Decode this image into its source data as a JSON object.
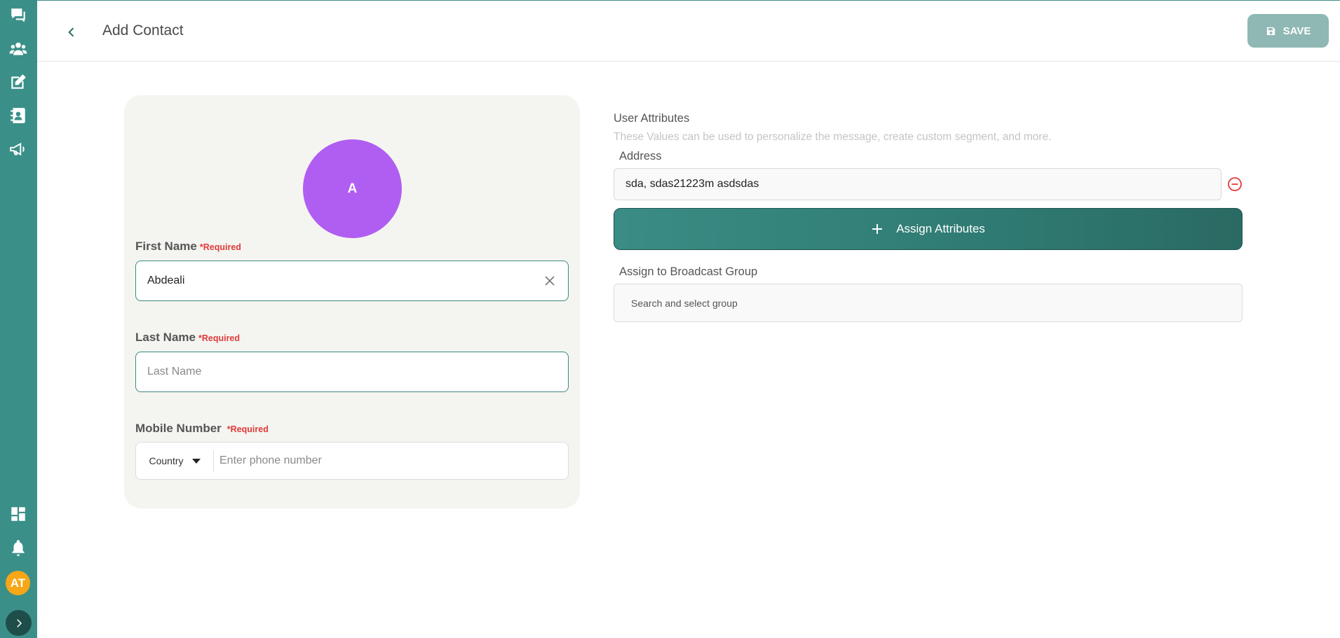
{
  "sidebar": {
    "icons": [
      "chat-icon",
      "users-icon",
      "edit-icon",
      "contacts-icon",
      "megaphone-icon"
    ],
    "bottom_icons": [
      "dashboard-icon",
      "bell-icon"
    ],
    "user_initials": "AT"
  },
  "header": {
    "title": "Add Contact",
    "save_label": "SAVE"
  },
  "contact_card": {
    "avatar_initial": "A",
    "avatar_color": "#b05ef2",
    "first_name": {
      "label": "First Name",
      "required": "*Required",
      "value": "Abdeali"
    },
    "last_name": {
      "label": "Last Name",
      "required": "*Required",
      "placeholder": "Last Name"
    },
    "mobile": {
      "label": "Mobile Number",
      "required": "*Required",
      "country_label": "Country",
      "placeholder": "Enter phone number"
    }
  },
  "attributes": {
    "title": "User Attributes",
    "subtitle": "These Values can be used to personalize the message, create custom segment, and more.",
    "address_label": "Address",
    "address_value": "sda, sdas21223m asdsdas",
    "assign_label": "Assign Attributes",
    "broadcast_label": "Assign to Broadcast Group",
    "broadcast_placeholder": "Search and select group"
  },
  "colors": {
    "sidebar": "#3a9088",
    "accent": "#2f7b73",
    "required": "#e03a3a",
    "user_avatar": "#f7a715"
  }
}
